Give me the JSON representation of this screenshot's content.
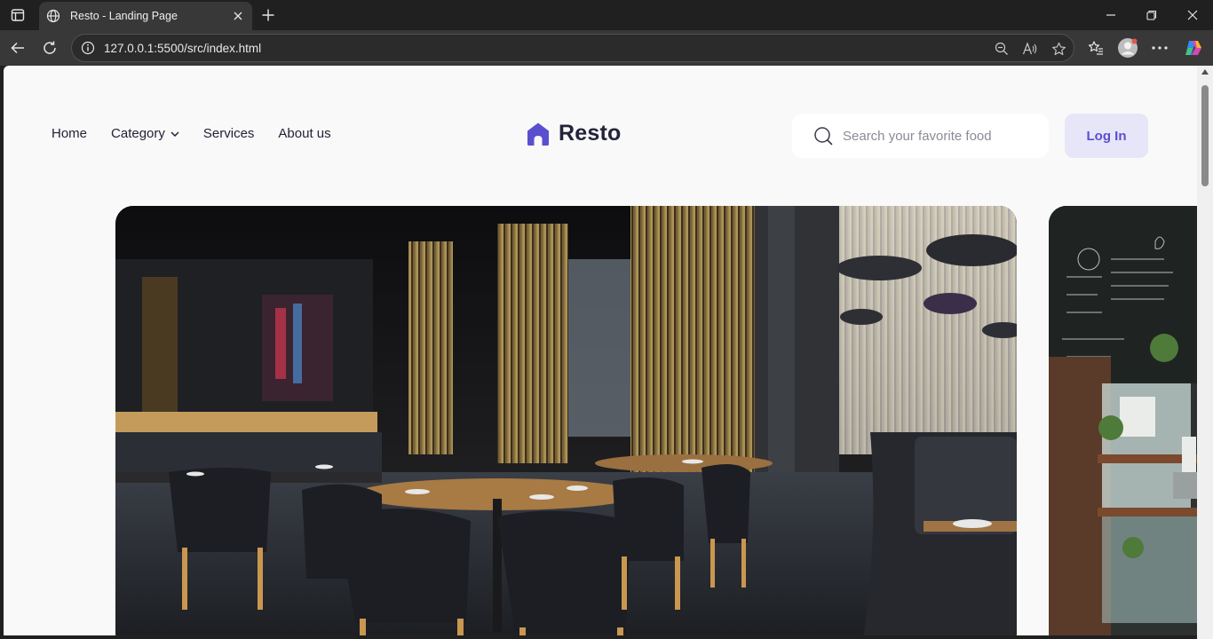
{
  "browser": {
    "tab_title": "Resto - Landing Page",
    "url": "127.0.0.1:5500/src/index.html"
  },
  "nav": {
    "items": [
      {
        "label": "Home"
      },
      {
        "label": "Category"
      },
      {
        "label": "Services"
      },
      {
        "label": "About us"
      }
    ]
  },
  "brand": {
    "name": "Resto",
    "accent": "#5a4fcf"
  },
  "search": {
    "placeholder": "Search your favorite food"
  },
  "actions": {
    "login_label": "Log In"
  }
}
